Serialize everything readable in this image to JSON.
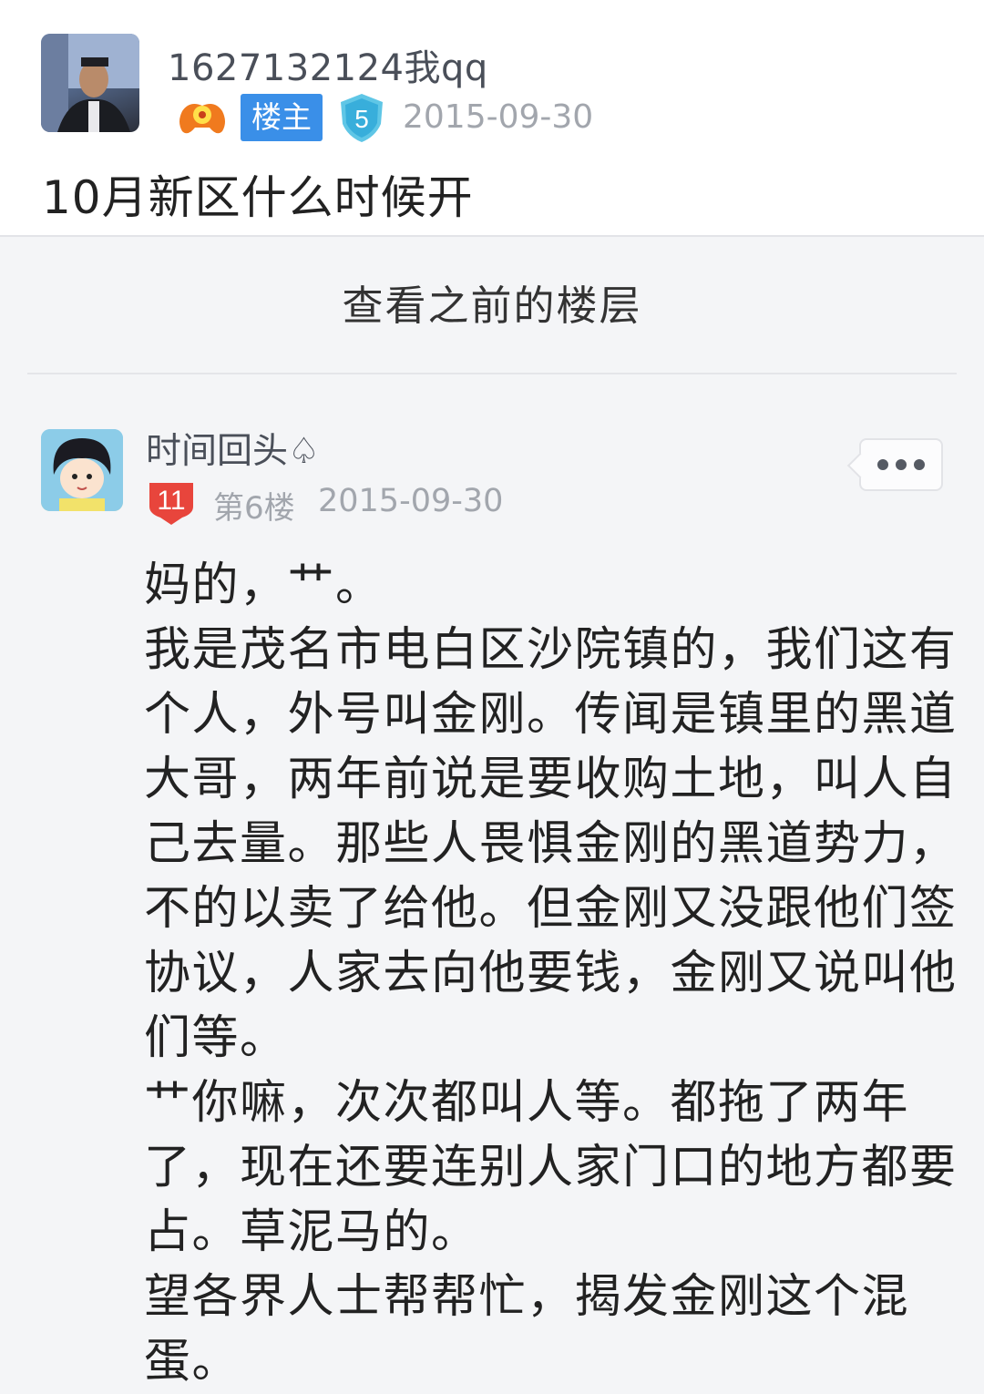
{
  "op": {
    "username": "1627132124我qq",
    "host_badge": "楼主",
    "shield_level": "5",
    "date": "2015-09-30",
    "title": "10月新区什么时候开"
  },
  "prev_floors_label": "查看之前的楼层",
  "reply": {
    "username": "时间回头♤",
    "user_level": "11",
    "floor": "第6楼",
    "date": "2015-09-30",
    "lines": [
      "妈的，艹。",
      "我是茂名市电白区沙院镇的，我们这有",
      "个人，外号叫金刚。传闻是镇里的黑道",
      "大哥，两年前说是要收购土地，叫人自",
      "己去量。那些人畏惧金刚的黑道势力，",
      "不的以卖了给他。但金刚又没跟他们签",
      "协议，人家去向他要钱，金刚又说叫他",
      "们等。",
      "艹你嘛，次次都叫人等。都拖了两年",
      "了，现在还要连别人家门口的地方都要",
      "占。草泥马的。",
      "望各界人士帮帮忙，揭发金刚这个混",
      "蛋。"
    ]
  },
  "colors": {
    "host_badge_bg": "#3a8fe8",
    "shield_badge": "#5fc6e6",
    "user_level_badge": "#e8453c"
  }
}
